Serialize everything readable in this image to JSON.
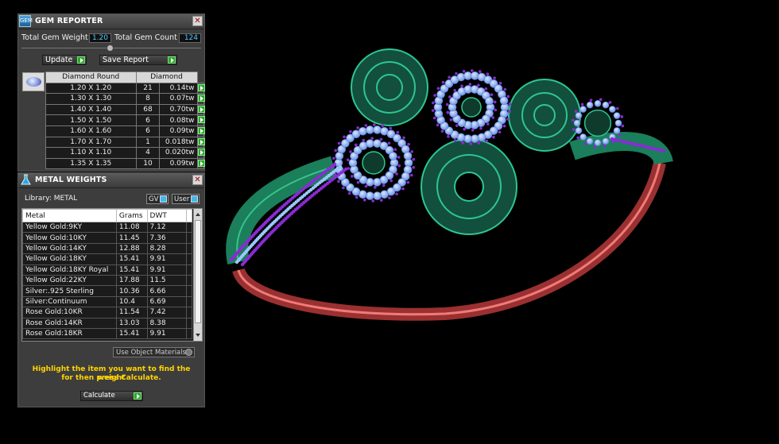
{
  "gem_reporter": {
    "title": "GEM REPORTER",
    "icon_text": "GEM",
    "total_weight_label": "Total Gem Weight",
    "total_weight_value": "1.20",
    "total_count_label": "Total Gem Count",
    "total_count_value": "124",
    "update_label": "Update",
    "save_label": "Save Report",
    "headers": [
      "Diamond Round",
      "Diamond"
    ],
    "rows": [
      {
        "size": "1.20 X 1.20",
        "count": "21",
        "weight": "0.14tw"
      },
      {
        "size": "1.30 X 1.30",
        "count": "8",
        "weight": "0.07tw"
      },
      {
        "size": "1.40 X 1.40",
        "count": "68",
        "weight": "0.70tw"
      },
      {
        "size": "1.50 X 1.50",
        "count": "6",
        "weight": "0.08tw"
      },
      {
        "size": "1.60 X 1.60",
        "count": "6",
        "weight": "0.09tw"
      },
      {
        "size": "1.70 X 1.70",
        "count": "1",
        "weight": "0.018tw"
      },
      {
        "size": "1.10 X 1.10",
        "count": "4",
        "weight": "0.020tw"
      },
      {
        "size": "1.35 X 1.35",
        "count": "10",
        "weight": "0.09tw"
      }
    ]
  },
  "metal_weights": {
    "title": "METAL WEIGHTS",
    "library_label": "Library:  METAL",
    "gv_label": "GV",
    "user_label": "User",
    "headers": [
      "Metal",
      "Grams",
      "DWT"
    ],
    "rows": [
      {
        "metal": "Yellow Gold:9KY",
        "grams": "11.08",
        "dwt": "7.12"
      },
      {
        "metal": "Yellow Gold:10KY",
        "grams": "11.45",
        "dwt": "7.36"
      },
      {
        "metal": "Yellow Gold:14KY",
        "grams": "12.88",
        "dwt": "8.28"
      },
      {
        "metal": "Yellow Gold:18KY",
        "grams": "15.41",
        "dwt": "9.91"
      },
      {
        "metal": "Yellow Gold:18KY Royal",
        "grams": "15.41",
        "dwt": "9.91"
      },
      {
        "metal": "Yellow Gold:22KY",
        "grams": "17.88",
        "dwt": "11.5"
      },
      {
        "metal": "Silver:.925 Sterling",
        "grams": "10.36",
        "dwt": "6.66"
      },
      {
        "metal": "Silver:Continuum",
        "grams": "10.4",
        "dwt": "6.69"
      },
      {
        "metal": "Rose Gold:10KR",
        "grams": "11.54",
        "dwt": "7.42"
      },
      {
        "metal": "Rose Gold:14KR",
        "grams": "13.03",
        "dwt": "8.38"
      },
      {
        "metal": "Rose Gold:18KR",
        "grams": "15.41",
        "dwt": "9.91"
      }
    ],
    "use_object_label": "Use Object Materials",
    "hint_line1": "Highlight the item you want to find the weight",
    "hint_line2": "for then press Calculate.",
    "calculate_label": "Calculate"
  },
  "colors": {
    "metal_green": "#1e8a63",
    "gem_blue": "#9cc7ff",
    "prong_purple": "#8a2bd4",
    "band_red": "#d24a4a"
  }
}
